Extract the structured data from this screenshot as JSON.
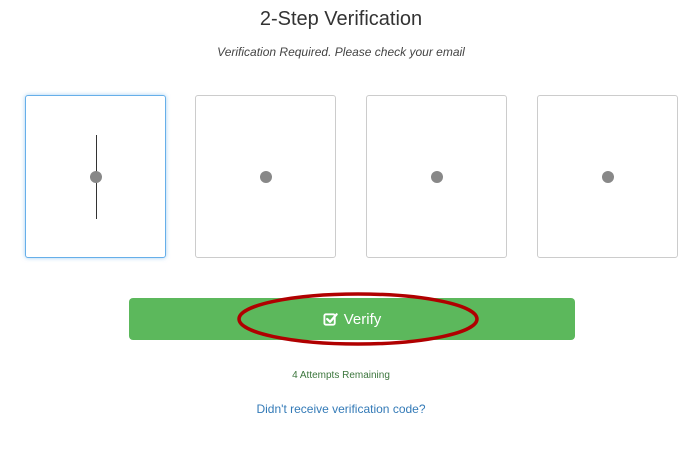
{
  "header": {
    "title": "2-Step Verification",
    "subtitle": "Verification Required. Please check your email"
  },
  "code_inputs": [
    {
      "state": "focused",
      "masked": true
    },
    {
      "state": "empty",
      "masked": true
    },
    {
      "state": "empty",
      "masked": true
    },
    {
      "state": "empty",
      "masked": true
    }
  ],
  "verify_button": {
    "label": "Verify",
    "icon": "check-square-icon",
    "color": "#5cb85c"
  },
  "annotation": {
    "shape": "ellipse",
    "color": "#b00000",
    "target": "verify-button"
  },
  "attempts_text": "4 Attempts Remaining",
  "resend_link": "Didn't receive verification code?",
  "colors": {
    "accent_green": "#5cb85c",
    "link_blue": "#337ab7",
    "focus_blue": "#66afe9",
    "attempts_green": "#3c763d"
  }
}
